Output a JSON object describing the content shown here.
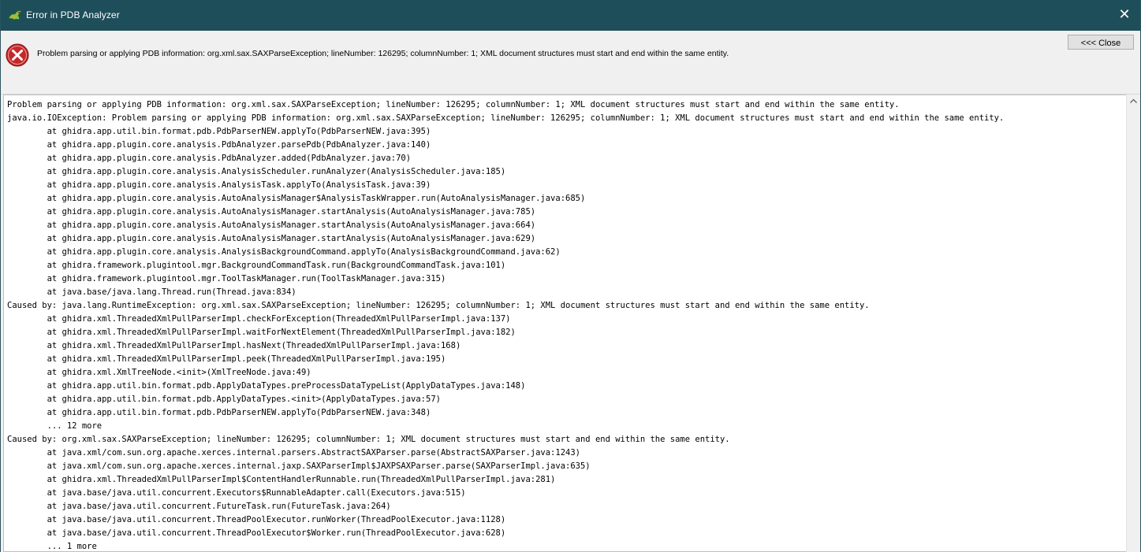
{
  "window": {
    "title": "Error in PDB Analyzer",
    "close_glyph": "✕"
  },
  "header": {
    "message": "Problem parsing or applying PDB information: org.xml.sax.SAXParseException; lineNumber: 126295; columnNumber: 1; XML document structures must start and end within the same entity.",
    "close_button_label": "<<< Close"
  },
  "trace": {
    "lines": [
      "Problem parsing or applying PDB information: org.xml.sax.SAXParseException; lineNumber: 126295; columnNumber: 1; XML document structures must start and end within the same entity.",
      "java.io.IOException: Problem parsing or applying PDB information: org.xml.sax.SAXParseException; lineNumber: 126295; columnNumber: 1; XML document structures must start and end within the same entity.",
      "        at ghidra.app.util.bin.format.pdb.PdbParserNEW.applyTo(PdbParserNEW.java:395)",
      "        at ghidra.app.plugin.core.analysis.PdbAnalyzer.parsePdb(PdbAnalyzer.java:140)",
      "        at ghidra.app.plugin.core.analysis.PdbAnalyzer.added(PdbAnalyzer.java:70)",
      "        at ghidra.app.plugin.core.analysis.AnalysisScheduler.runAnalyzer(AnalysisScheduler.java:185)",
      "        at ghidra.app.plugin.core.analysis.AnalysisTask.applyTo(AnalysisTask.java:39)",
      "        at ghidra.app.plugin.core.analysis.AutoAnalysisManager$AnalysisTaskWrapper.run(AutoAnalysisManager.java:685)",
      "        at ghidra.app.plugin.core.analysis.AutoAnalysisManager.startAnalysis(AutoAnalysisManager.java:785)",
      "        at ghidra.app.plugin.core.analysis.AutoAnalysisManager.startAnalysis(AutoAnalysisManager.java:664)",
      "        at ghidra.app.plugin.core.analysis.AutoAnalysisManager.startAnalysis(AutoAnalysisManager.java:629)",
      "        at ghidra.app.plugin.core.analysis.AnalysisBackgroundCommand.applyTo(AnalysisBackgroundCommand.java:62)",
      "        at ghidra.framework.plugintool.mgr.BackgroundCommandTask.run(BackgroundCommandTask.java:101)",
      "        at ghidra.framework.plugintool.mgr.ToolTaskManager.run(ToolTaskManager.java:315)",
      "        at java.base/java.lang.Thread.run(Thread.java:834)",
      "Caused by: java.lang.RuntimeException: org.xml.sax.SAXParseException; lineNumber: 126295; columnNumber: 1; XML document structures must start and end within the same entity.",
      "        at ghidra.xml.ThreadedXmlPullParserImpl.checkForException(ThreadedXmlPullParserImpl.java:137)",
      "        at ghidra.xml.ThreadedXmlPullParserImpl.waitForNextElement(ThreadedXmlPullParserImpl.java:182)",
      "        at ghidra.xml.ThreadedXmlPullParserImpl.hasNext(ThreadedXmlPullParserImpl.java:168)",
      "        at ghidra.xml.ThreadedXmlPullParserImpl.peek(ThreadedXmlPullParserImpl.java:195)",
      "        at ghidra.xml.XmlTreeNode.<init>(XmlTreeNode.java:49)",
      "        at ghidra.app.util.bin.format.pdb.ApplyDataTypes.preProcessDataTypeList(ApplyDataTypes.java:148)",
      "        at ghidra.app.util.bin.format.pdb.ApplyDataTypes.<init>(ApplyDataTypes.java:57)",
      "        at ghidra.app.util.bin.format.pdb.PdbParserNEW.applyTo(PdbParserNEW.java:348)",
      "        ... 12 more",
      "Caused by: org.xml.sax.SAXParseException; lineNumber: 126295; columnNumber: 1; XML document structures must start and end within the same entity.",
      "        at java.xml/com.sun.org.apache.xerces.internal.parsers.AbstractSAXParser.parse(AbstractSAXParser.java:1243)",
      "        at java.xml/com.sun.org.apache.xerces.internal.jaxp.SAXParserImpl$JAXPSAXParser.parse(SAXParserImpl.java:635)",
      "        at ghidra.xml.ThreadedXmlPullParserImpl$ContentHandlerRunnable.run(ThreadedXmlPullParserImpl.java:281)",
      "        at java.base/java.util.concurrent.Executors$RunnableAdapter.call(Executors.java:515)",
      "        at java.base/java.util.concurrent.FutureTask.run(FutureTask.java:264)",
      "        at java.base/java.util.concurrent.ThreadPoolExecutor.runWorker(ThreadPoolExecutor.java:1128)",
      "        at java.base/java.util.concurrent.ThreadPoolExecutor$Worker.run(ThreadPoolExecutor.java:628)",
      "        ... 1 more"
    ]
  }
}
